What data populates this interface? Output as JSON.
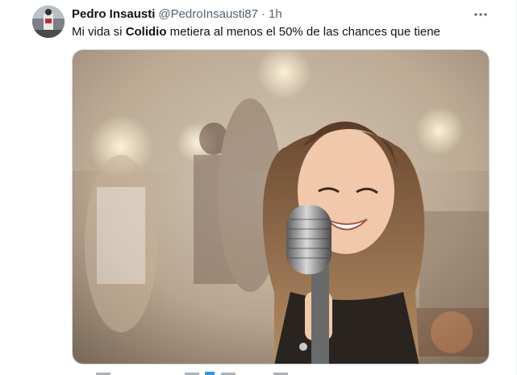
{
  "tweet": {
    "author_name": "Pedro Insausti",
    "author_handle": "@PedroInsausti87",
    "separator": "·",
    "time": "1h",
    "text_before": "Mi vida si ",
    "text_bold": "Colidio",
    "text_after": " metiera al menos el 50% de las chances que tiene"
  },
  "icons": {
    "more": "more-horizontal-icon"
  },
  "colors": {
    "text_primary": "#0f1419",
    "text_secondary": "#536471",
    "border": "#cfd9de"
  }
}
